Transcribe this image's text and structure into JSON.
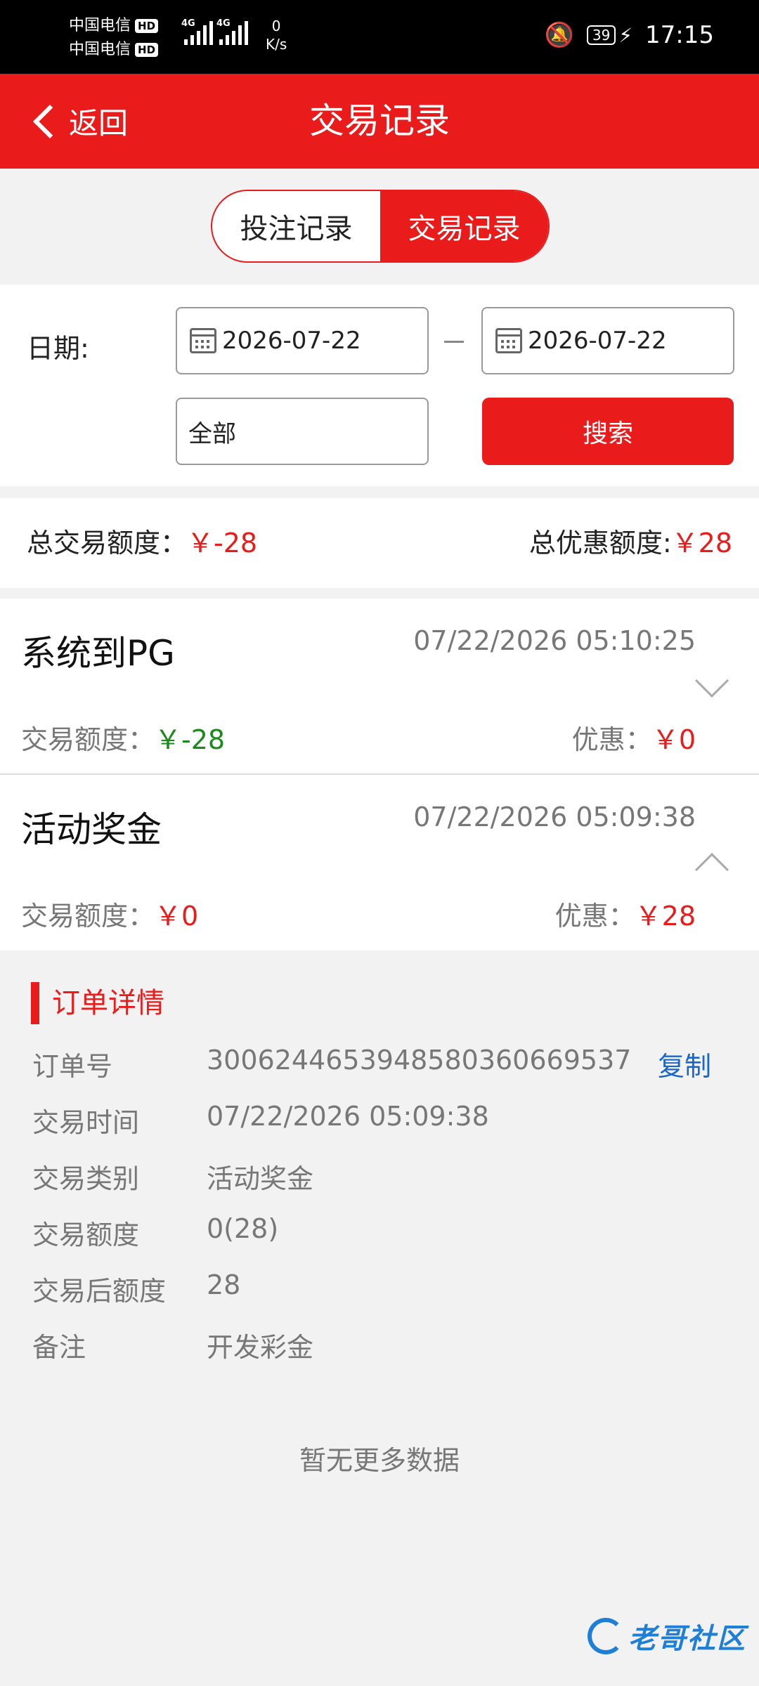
{
  "status_bar": {
    "carrier1": "中国电信",
    "carrier2": "中国电信",
    "hd": "HD",
    "network": "4G",
    "speed_value": "0",
    "speed_unit": "K/s",
    "battery": "39",
    "time": "17:15"
  },
  "header": {
    "back_label": "返回",
    "title": "交易记录"
  },
  "tabs": [
    {
      "label": "投注记录",
      "active": false
    },
    {
      "label": "交易记录",
      "active": true
    }
  ],
  "filter": {
    "date_label": "日期:",
    "start_date": "2026-07-22",
    "end_date": "2026-07-22",
    "type_value": "全部",
    "search_label": "搜索"
  },
  "totals": {
    "total_label": "总交易额度：",
    "total_value": "￥-28",
    "discount_label": "总优惠额度:",
    "discount_value": "￥28"
  },
  "records": [
    {
      "name": "系统到PG",
      "time": "07/22/2026 05:10:25",
      "amount_label": "交易额度：",
      "amount": "￥-28",
      "discount_label": "优惠：",
      "discount": "￥0"
    },
    {
      "name": "活动奖金",
      "time": "07/22/2026 05:09:38",
      "amount_label": "交易额度：",
      "amount": "￥0",
      "discount_label": "优惠：",
      "discount": "￥28"
    }
  ],
  "details": {
    "title": "订单详情",
    "copy_label": "复制",
    "rows": [
      {
        "k": "订单号",
        "v": "300624465394858036066953​7"
      },
      {
        "k": "交易时间",
        "v": "07/22/2026 05:09:38"
      },
      {
        "k": "交易类别",
        "v": "活动奖金"
      },
      {
        "k": "交易额度",
        "v": "0(28)"
      },
      {
        "k": "交易后额度",
        "v": "28"
      },
      {
        "k": "备注",
        "v": "开发彩金"
      }
    ]
  },
  "footer": {
    "no_more": "暂无更多数据"
  },
  "watermark": {
    "text": "老哥社区"
  },
  "colors": {
    "primary": "#e91b1b",
    "positive": "#1d8a1d",
    "link": "#1a66c9"
  }
}
